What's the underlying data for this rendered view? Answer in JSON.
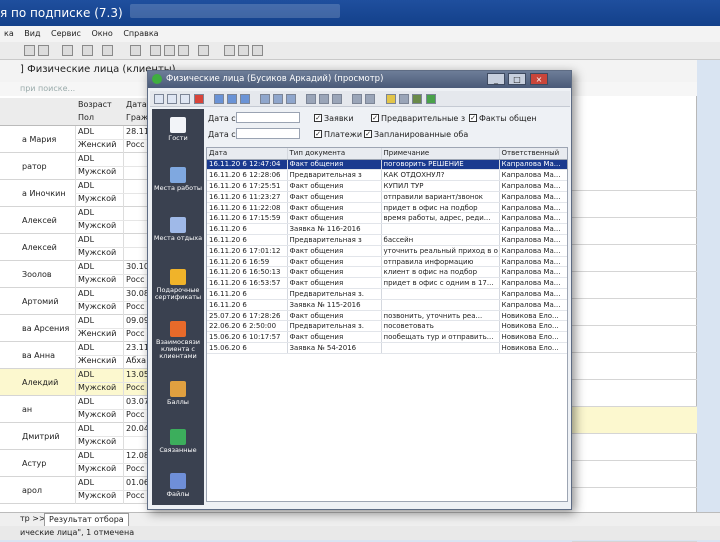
{
  "app": {
    "title": "я по подписке (7.3)",
    "menu": [
      "ка",
      "Вид",
      "Сервис",
      "Окно",
      "Справка"
    ]
  },
  "background": {
    "window_title": "] Физические лица (клиенты)",
    "subtitle": "при поиске...",
    "col_headers": {
      "age": "Возраст",
      "sex": "Пол",
      "date": "Дата",
      "citizenship": "Граж"
    },
    "rows": [
      {
        "name": "а Мария",
        "age": "ADL",
        "sex": "Женский",
        "date": "28.11.",
        "country": "Росс",
        "highlight": false
      },
      {
        "name": "ратор",
        "age": "ADL",
        "sex": "Мужской",
        "date": "",
        "country": "",
        "highlight": false
      },
      {
        "name": "а Иночкин",
        "age": "ADL",
        "sex": "Мужской",
        "date": "",
        "country": "",
        "highlight": false
      },
      {
        "name": "Алексей",
        "age": "ADL",
        "sex": "Мужской",
        "date": "",
        "country": "",
        "highlight": false
      },
      {
        "name": "Алексей",
        "age": "ADL",
        "sex": "Мужской",
        "date": "",
        "country": "",
        "highlight": false
      },
      {
        "name": "Зоолов",
        "age": "ADL",
        "sex": "Мужской",
        "date": "30.10",
        "country": "Росс",
        "highlight": false
      },
      {
        "name": "Артомий",
        "age": "ADL",
        "sex": "Мужской",
        "date": "30.08.",
        "country": "Росс",
        "highlight": false
      },
      {
        "name": "ва Арсения",
        "age": "ADL",
        "sex": "Женский",
        "date": "09.09.",
        "country": "Росс",
        "highlight": false
      },
      {
        "name": "ва Анна",
        "age": "ADL",
        "sex": "Женский",
        "date": "23.11.",
        "country": "Абха",
        "highlight": false
      },
      {
        "name": "Алекдий",
        "age": "ADL",
        "sex": "Мужской",
        "date": "13.05.",
        "country": "Росс",
        "highlight": true
      },
      {
        "name": "ан",
        "age": "ADL",
        "sex": "Мужской",
        "date": "03.07.",
        "country": "Росс",
        "highlight": false
      },
      {
        "name": "Дмитрий",
        "age": "ADL",
        "sex": "Мужской",
        "date": "20.04.",
        "country": "",
        "highlight": false
      },
      {
        "name": "Астур",
        "age": "ADL",
        "sex": "Мужской",
        "date": "12.08.",
        "country": "Росс",
        "highlight": false
      },
      {
        "name": "арол",
        "age": "ADL",
        "sex": "Мужской",
        "date": "01.06.",
        "country": "Росс",
        "highlight": false
      }
    ],
    "bottom_tab_prefix": "тр >>",
    "bottom_tab": "Результат отбора",
    "status": "ические лица\", 1 отмечена"
  },
  "dialog": {
    "title": "Физические лица (Бусиков Аркадий) (просмотр)",
    "buttons": {
      "minimize": "_",
      "maximize": "□",
      "close": "×"
    },
    "left_panel": [
      {
        "label": "Гости",
        "color": "#f2f4f8"
      },
      {
        "label": "Места работы",
        "color": "#7fa8e0"
      },
      {
        "label": "Места отдыха",
        "color": "#9fb9e8"
      },
      {
        "label": "Подарочные сертификаты",
        "color": "#f0b32a"
      },
      {
        "label": "Взаимосвязи клиента с клиентами",
        "color": "#e86a2a"
      },
      {
        "label": "Баллы",
        "color": "#e0a040"
      },
      {
        "label": "Связанные",
        "color": "#3cae5c"
      },
      {
        "label": "Файлы",
        "color": "#6f8fd8"
      }
    ],
    "filter": {
      "date_from_label": "Дата с",
      "date_to_label": "Дата с",
      "checks": [
        {
          "label": "Заявки",
          "checked": true
        },
        {
          "label": "Предварительные з",
          "checked": true
        },
        {
          "label": "Факты общен",
          "checked": true
        },
        {
          "label": "Платежи",
          "checked": true
        },
        {
          "label": "Заплани­рованные оба",
          "checked": true
        }
      ]
    },
    "grid": {
      "headers": [
        "Дата",
        "Тип документа",
        "Примечание",
        "Ответственный"
      ],
      "rows": [
        [
          "16.11.20 6 12:47:04",
          "Факт общения",
          "поговорить РЕШЕНИЕ",
          "Капралова Ма...",
          true
        ],
        [
          "16.11.20 6 12:28:06",
          "Предварительная з",
          "КАК ОТДОХНУЛ?",
          "Капралова Ма...",
          false
        ],
        [
          "16.11.20 6 17:25:51",
          "Факт общения",
          "КУПИЛ ТУР",
          "Капралова Ма...",
          false
        ],
        [
          "16.11.20 6 11:23:27",
          "Факт общения",
          "отправили вариант/звонок",
          "Капралова Ма...",
          false
        ],
        [
          "16.11.20 6 11:22:08",
          "Факт общения",
          "придет в офис на подбор",
          "Капралова Ма...",
          false
        ],
        [
          "16.11.20 6 17:15:59",
          "Факт общения",
          "время работы, адрес, реди...",
          "Капралова Ма...",
          false
        ],
        [
          "16.11.20 6",
          "Заявка № 116-2016",
          "",
          "Капралова Ма...",
          false
        ],
        [
          "16.11.20 6",
          "Предварительная з",
          "бассейн",
          "Капралова Ма...",
          false
        ],
        [
          "16.11.20 6 17:01:12",
          "Факт общения",
          "уточнить реальный приход в о",
          "Капралова Ма...",
          false
        ],
        [
          "16.11.20 6 16:59",
          "Факт общения",
          "отправила информацию",
          "Капралова Ма...",
          false
        ],
        [
          "16.11.20 6 16:50:13",
          "Факт общения",
          "клиент в офис на подбор",
          "Капралова Ма...",
          false
        ],
        [
          "16.11.20 6 16:53:57",
          "Факт общения",
          "придет в офис с одним в 17...",
          "Капралова Ма...",
          false
        ],
        [
          "16.11.20 6",
          "Предварительная з.",
          "",
          "Капралова Ма...",
          false
        ],
        [
          "16.11.20 6",
          "Заявка № 115-2016",
          "",
          "Капралова Ма...",
          false
        ],
        [
          "25.07.20 6 17:28:26",
          "Факт общения",
          "позвонить, уточнить реа...",
          "Новикова Ело...",
          false
        ],
        [
          "22.06.20 6 2:50:00",
          "Предварительная з.",
          "посоветовать",
          "Новикова Ело...",
          false
        ],
        [
          "15.06.20 6 10:17:57",
          "Факт общения",
          "пообещать тур и отправить...",
          "Новикова Ело...",
          false
        ],
        [
          "15.06.20 6",
          "Заявка № 54-2016",
          "",
          "Новикова Ело...",
          false
        ]
      ]
    }
  }
}
